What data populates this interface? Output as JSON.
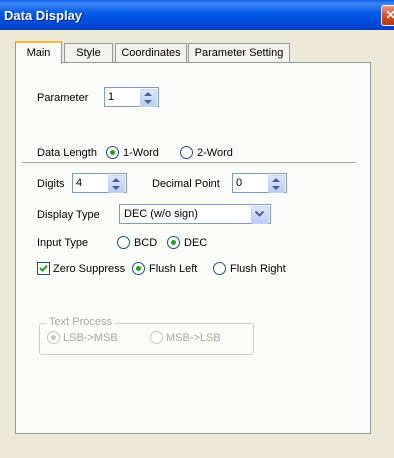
{
  "window": {
    "title": "Data Display",
    "close_label": "✕"
  },
  "tabs": [
    "Main",
    "Style",
    "Coordinates",
    "Parameter Setting"
  ],
  "main": {
    "parameter": {
      "label": "Parameter",
      "value": "1"
    },
    "data_length": {
      "label": "Data Length",
      "options": [
        "1-Word",
        "2-Word"
      ],
      "selected": "1-Word"
    },
    "digits": {
      "label": "Digits",
      "value": "4"
    },
    "decimal_point": {
      "label": "Decimal Point",
      "value": "0"
    },
    "display_type": {
      "label": "Display Type",
      "value": "DEC (w/o sign)"
    },
    "input_type": {
      "label": "Input Type",
      "options": [
        "BCD",
        "DEC"
      ],
      "selected": "DEC"
    },
    "zero_suppress": {
      "label": "Zero Suppress",
      "checked": true
    },
    "flush": {
      "options": [
        "Flush Left",
        "Flush Right"
      ],
      "selected": "Flush Left"
    },
    "text_process": {
      "label": "Text Process",
      "options": [
        "LSB->MSB",
        "MSB->LSB"
      ],
      "selected": "LSB->MSB",
      "disabled": true
    }
  }
}
